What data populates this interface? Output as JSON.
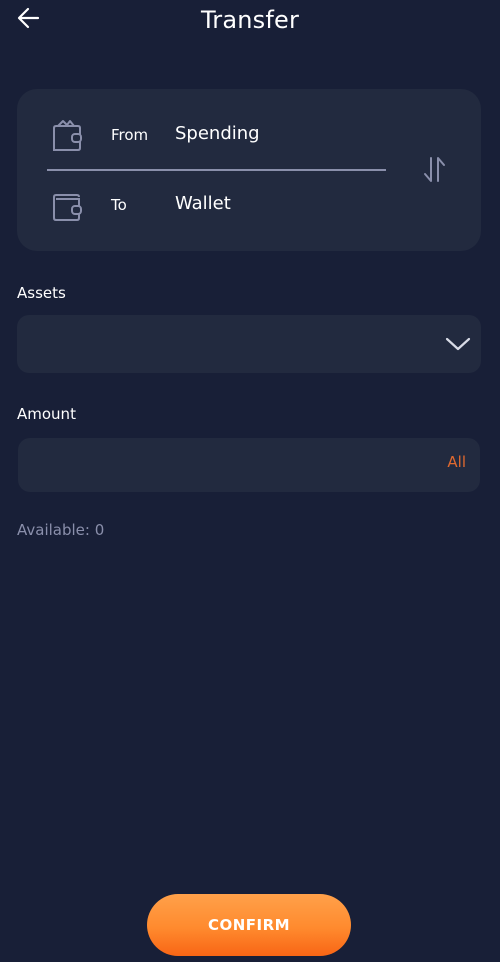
{
  "header": {
    "title": "Transfer",
    "back_icon": "arrow-left-icon"
  },
  "transfer_card": {
    "from": {
      "label": "From",
      "value": "Spending",
      "icon": "wallet-open-icon"
    },
    "to": {
      "label": "To",
      "value": "Wallet",
      "icon": "wallet-icon"
    },
    "swap_icon": "swap-vertical-arrows-icon"
  },
  "assets": {
    "label": "Assets",
    "selected": "",
    "dropdown_icon": "chevron-down-icon"
  },
  "amount": {
    "label": "Amount",
    "value": "",
    "placeholder": "",
    "all_label": "All"
  },
  "available": "Available: 0",
  "confirm_label": "CONFIRM",
  "colors": {
    "background": "#181f37",
    "card": "#222a3f",
    "accent": "#e0692f",
    "muted": "#8a8fab",
    "button_gradient_top": "#ffa14a",
    "button_gradient_bottom": "#f86515"
  }
}
